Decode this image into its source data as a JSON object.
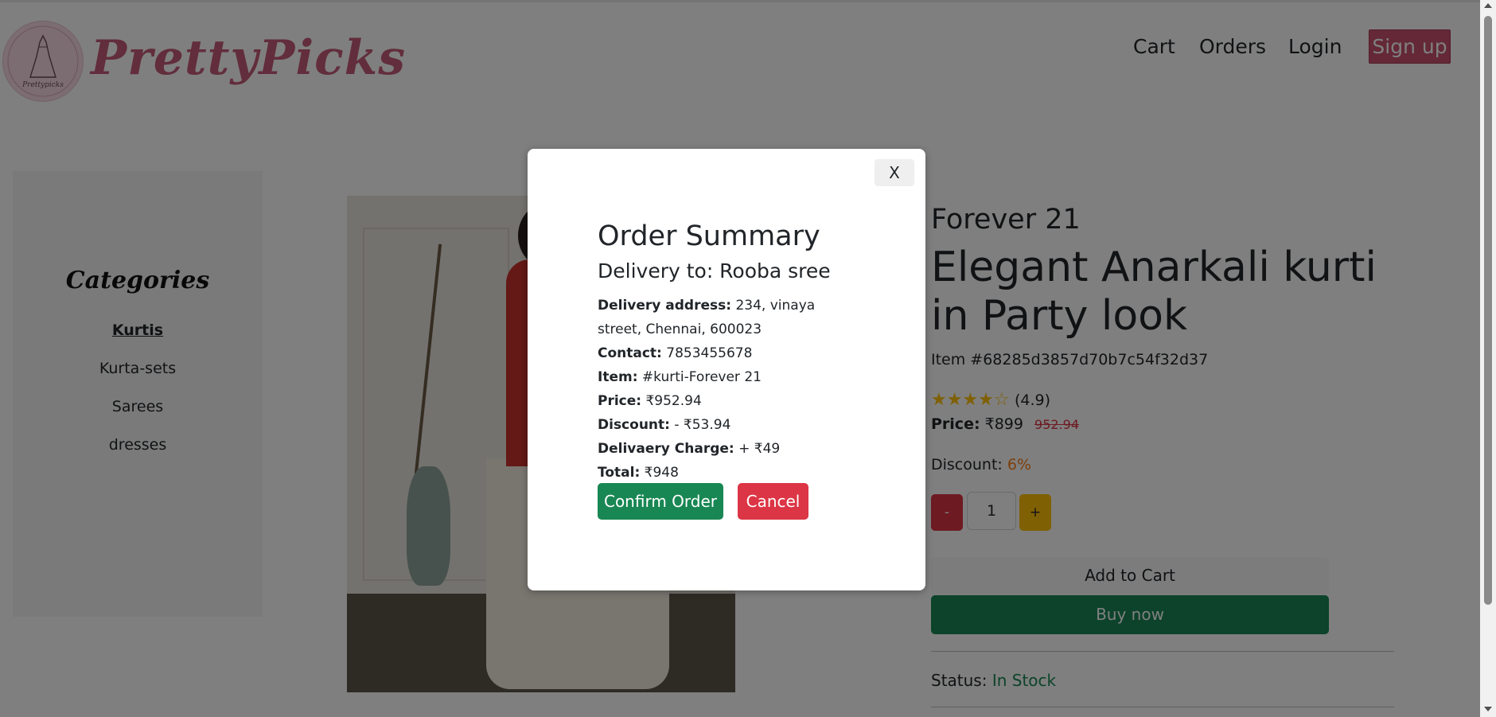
{
  "header": {
    "brand": "PrettyPicks",
    "logo_caption": "Prettypicks",
    "nav": [
      {
        "label": "Cart"
      },
      {
        "label": "Orders"
      },
      {
        "label": "Login"
      },
      {
        "label": "Sign up"
      }
    ]
  },
  "sidebar": {
    "title": "Categories",
    "items": [
      {
        "label": "Kurtis",
        "active": true
      },
      {
        "label": "Kurta-sets"
      },
      {
        "label": "Sarees"
      },
      {
        "label": "dresses"
      }
    ]
  },
  "product": {
    "brand": "Forever 21",
    "title": "Elegant Anarkali kurti in Party look",
    "item_id": "Item #68285d3857d70b7c54f32d37",
    "stars": "★★★★☆",
    "rating": "(4.9)",
    "price_label": "Price:",
    "price": "₹899",
    "old_price": "952.94",
    "discount_label": "Discount:",
    "discount_value": "6%",
    "qty_minus": "-",
    "qty_value": "1",
    "qty_plus": "+",
    "add_to_cart": "Add to Cart",
    "buy_now": "Buy now",
    "status_label": "Status:",
    "status_value": "In Stock"
  },
  "modal": {
    "close": "X",
    "title": "Order Summary",
    "delivery_to": "Delivery to: Rooba sree",
    "address_label": "Delivery address:",
    "address_value": "234, vinaya street, Chennai, 600023",
    "contact_label": "Contact:",
    "contact_value": "7853455678",
    "item_label": "Item:",
    "item_value": "#kurti-Forever 21",
    "price_label": "Price:",
    "price_value": "₹952.94",
    "discount_label": "Discount:",
    "discount_value": "- ₹53.94",
    "delivery_charge_label": "Delivaery Charge:",
    "delivery_charge_value": "+ ₹49",
    "total_label": "Total:",
    "total_value": "₹948",
    "confirm": "Confirm Order",
    "cancel": "Cancel"
  },
  "colors": {
    "brand_pink": "#c45a78",
    "success": "#198754",
    "danger": "#dc3545",
    "warning": "#ffc107",
    "discount_orange": "#fd7e14"
  }
}
